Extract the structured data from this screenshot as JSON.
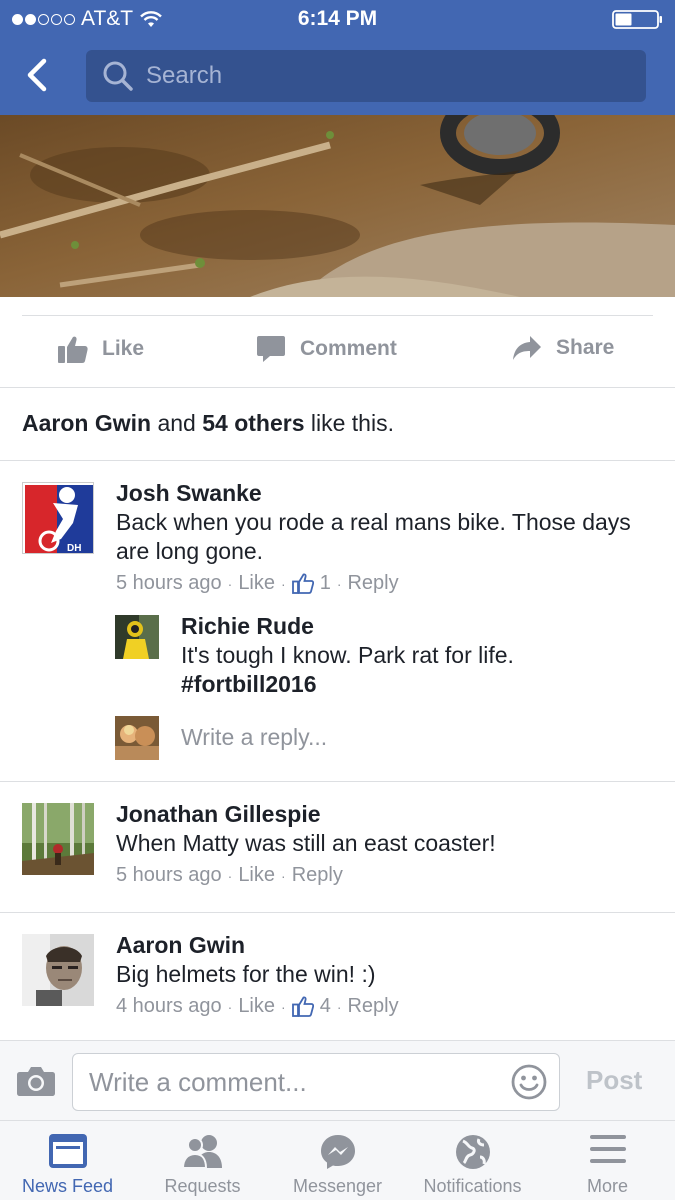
{
  "status_bar": {
    "carrier": "AT&T",
    "time": "6:14 PM",
    "signal_bars": 2
  },
  "header": {
    "search_placeholder": "Search"
  },
  "post_actions": {
    "like": "Like",
    "comment": "Comment",
    "share": "Share"
  },
  "likes_summary": {
    "first_name": "Aaron Gwin",
    "connector": " and ",
    "others": "54 others",
    "suffix": " like this."
  },
  "comments": [
    {
      "name": "Josh Swanke",
      "text": "Back when you rode a real mans bike. Those days are long gone.",
      "time": "5 hours ago",
      "like": "Like",
      "reactions": "1",
      "reply": "Reply",
      "replies": [
        {
          "name": "Richie Rude",
          "text": "It's tough I know. Park rat for life.",
          "tag": "#fortbill2016"
        }
      ],
      "reply_placeholder": "Write a reply..."
    },
    {
      "name": "Jonathan Gillespie",
      "text": "When Matty was still an east coaster!",
      "time": "5 hours ago",
      "like": "Like",
      "reply": "Reply"
    },
    {
      "name": "Aaron Gwin",
      "text": "Big helmets for the win! :)",
      "time": "4 hours ago",
      "like": "Like",
      "reactions": "4",
      "reply": "Reply"
    }
  ],
  "composer": {
    "placeholder": "Write a comment...",
    "post_label": "Post"
  },
  "tabs": [
    {
      "label": "News Feed",
      "icon": "news-feed-icon",
      "active": true
    },
    {
      "label": "Requests",
      "icon": "friend-requests-icon"
    },
    {
      "label": "Messenger",
      "icon": "messenger-icon"
    },
    {
      "label": "Notifications",
      "icon": "globe-icon"
    },
    {
      "label": "More",
      "icon": "menu-icon"
    }
  ],
  "colors": {
    "brand": "#4267b2",
    "muted": "#90949c",
    "text": "#1d2129"
  }
}
